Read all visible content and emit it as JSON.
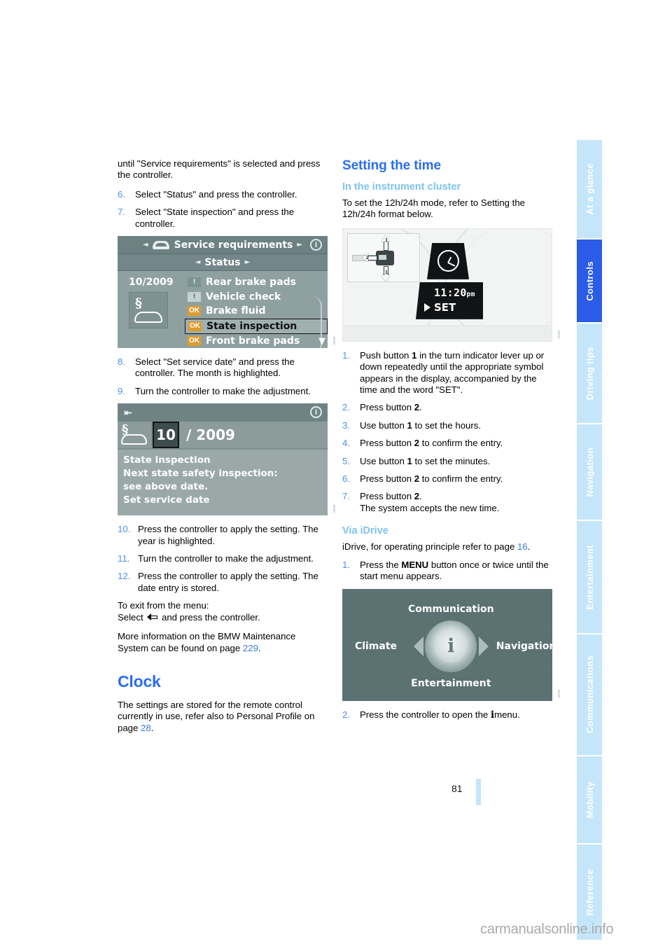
{
  "document": {
    "page_number": "81",
    "watermark": "carmanualsonline.info"
  },
  "tabs": [
    {
      "label": "At a glance",
      "active": false
    },
    {
      "label": "Controls",
      "active": true
    },
    {
      "label": "Driving tips",
      "active": false
    },
    {
      "label": "Navigation",
      "active": false
    },
    {
      "label": "Entertainment",
      "active": false
    },
    {
      "label": "Communications",
      "active": false
    },
    {
      "label": "Mobility",
      "active": false
    },
    {
      "label": "Reference",
      "active": false
    }
  ],
  "left_column": {
    "continued_text": "until \"Service requirements\" is selected and press the controller.",
    "steps_a": [
      {
        "num": "6.",
        "text": "Select \"Status\" and press the controller."
      },
      {
        "num": "7.",
        "text": "Select \"State inspection\" and press the controller."
      }
    ],
    "figure_service_requirements": {
      "title": "Service requirements",
      "subtitle": "Status",
      "date": "10/2009",
      "info_icon": "i",
      "items": [
        {
          "status": "warn-dark",
          "status_label": "",
          "label": "Rear brake pads",
          "selected": false
        },
        {
          "status": "warn-light",
          "status_label": "",
          "label": "Vehicle check",
          "selected": false
        },
        {
          "status": "ok",
          "status_label": "OK",
          "label": "Brake fluid",
          "selected": false
        },
        {
          "status": "ok",
          "status_label": "OK",
          "label": "State inspection",
          "selected": true
        },
        {
          "status": "ok",
          "status_label": "OK",
          "label": "Front brake pads",
          "selected": false
        }
      ]
    },
    "steps_b": [
      {
        "num": "8.",
        "text": "Select \"Set service date\" and press the controller. The month is highlighted."
      },
      {
        "num": "9.",
        "text": "Turn the controller to make the adjustment."
      }
    ],
    "figure_set_service_date": {
      "month": "10",
      "year": "/ 2009",
      "info_icon": "i",
      "lines": [
        "State inspection",
        "Next state safety inspection:",
        "see above date.",
        "Set service date"
      ]
    },
    "steps_c": [
      {
        "num": "10.",
        "text": "Press the controller to apply the setting. The year is highlighted."
      },
      {
        "num": "11.",
        "text": "Turn the controller to make the adjustment."
      },
      {
        "num": "12.",
        "text": "Press the controller to apply the setting. The date entry is stored."
      }
    ],
    "exit_line1": "To exit from the menu:",
    "exit_line2_prefix": "Select",
    "exit_line2_suffix": "and press the controller.",
    "more_info_prefix": "More information on the BMW Maintenance System can be found on page",
    "more_info_page": "229",
    "more_info_suffix": ".",
    "clock_heading": "Clock",
    "clock_text_prefix": "The settings are stored for the remote control currently in use, refer also to Personal Profile on page",
    "clock_text_page": "28",
    "clock_text_suffix": "."
  },
  "right_column": {
    "heading": "Setting the time",
    "subheading_cluster": "In the instrument cluster",
    "cluster_intro": "To set the 12h/24h mode, refer to Setting the 12h/24h format below.",
    "figure_cluster": {
      "time": "11:20",
      "ampm": "pm",
      "set_label": "SET",
      "callout_1": "1",
      "callout_1b": "1",
      "callout_2": "2"
    },
    "steps_cluster": [
      {
        "num": "1.",
        "text": "Push button 1 in the turn indicator lever up or down repeatedly until the appropriate symbol appears in the display, accompanied by the time and the word \"SET\"."
      },
      {
        "num": "2.",
        "text": "Press button 2."
      },
      {
        "num": "3.",
        "text": "Use button 1 to set the hours."
      },
      {
        "num": "4.",
        "text": "Press button 2 to confirm the entry."
      },
      {
        "num": "5.",
        "text": "Use button 1 to set the minutes."
      },
      {
        "num": "6.",
        "text": "Press button 2 to confirm the entry."
      },
      {
        "num": "7.",
        "text": "Press button 2. The system accepts the new time."
      }
    ],
    "subheading_idrive": "Via iDrive",
    "idrive_intro_prefix": "iDrive, for operating principle refer to page",
    "idrive_intro_page": "16",
    "idrive_intro_suffix": ".",
    "idrive_step1_num": "1.",
    "idrive_step1_text": "Press the MENU button once or twice until the start menu appears.",
    "idrive_step1_bold": "MENU",
    "figure_start_menu": {
      "top": "Communication",
      "left": "Climate",
      "right": "Navigation",
      "bottom": "Entertainment",
      "center_icon": "i"
    },
    "idrive_step2_num": "2.",
    "idrive_step2_text_a": "Press the controller to open the",
    "idrive_step2_icon": "i",
    "idrive_step2_text_b": "menu."
  },
  "colors": {
    "accent_blue": "#2a6ef0",
    "light_blue": "#7fc3ef",
    "tab_light": "#c5e6fa",
    "tab_active": "#2a5ce8",
    "screen_green": "#8fa0a0"
  }
}
